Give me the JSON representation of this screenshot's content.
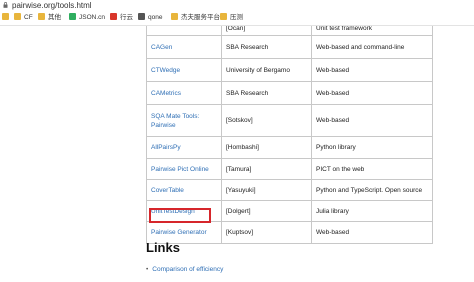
{
  "browser": {
    "url": "pairwise.org/tools.html",
    "bookmarks": [
      {
        "label": "",
        "icon": "folder-icon"
      },
      {
        "label": "CF",
        "icon": "folder-icon"
      },
      {
        "label": "其他",
        "icon": "folder-icon"
      },
      {
        "label": "JSON.cn",
        "icon": "json-icon"
      },
      {
        "label": "行云",
        "icon": "cloud-icon"
      },
      {
        "label": "qone",
        "icon": "qone-icon"
      },
      {
        "label": "杰夫服务平台",
        "icon": "folder-icon"
      },
      {
        "label": "压测",
        "icon": "folder-icon"
      }
    ]
  },
  "table": {
    "rows": [
      {
        "name": "",
        "author": "[Ocan]",
        "type": "Unit test framework",
        "height": 15
      },
      {
        "name": "CAGen",
        "author": "SBA Research",
        "type": "Web-based and command-line",
        "height": 23
      },
      {
        "name": "CTWedge",
        "author": "University of Bergamo",
        "type": "Web-based",
        "height": 23
      },
      {
        "name": "CAMetrics",
        "author": "SBA Research",
        "type": "Web-based",
        "height": 23
      },
      {
        "name": "SQA Mate Tools: Pairwise",
        "author": "[Sotskov]",
        "type": "Web-based",
        "height": 32
      },
      {
        "name": "AllPairsPy",
        "author": "[Hombashi]",
        "type": "Python library",
        "height": 22
      },
      {
        "name": "Pairwise Pict Online",
        "author": "[Tamura]",
        "type": "PICT on the web",
        "height": 21
      },
      {
        "name": "CoverTable",
        "author": "[Yasuyuki]",
        "type": "Python and TypeScript. Open source",
        "height": 21
      },
      {
        "name": "UnitTestDesign",
        "author": "[Dolgert]",
        "type": "Julia library",
        "height": 21
      },
      {
        "name": "Pairwise Generator",
        "author": "[Kuptsov]",
        "type": "Web-based",
        "height": 22
      }
    ]
  },
  "links": {
    "heading": "Links",
    "items": [
      "Comparison of efficiency"
    ]
  },
  "colors": {
    "link": "#2f6fb5",
    "highlight": "#d6262b"
  }
}
